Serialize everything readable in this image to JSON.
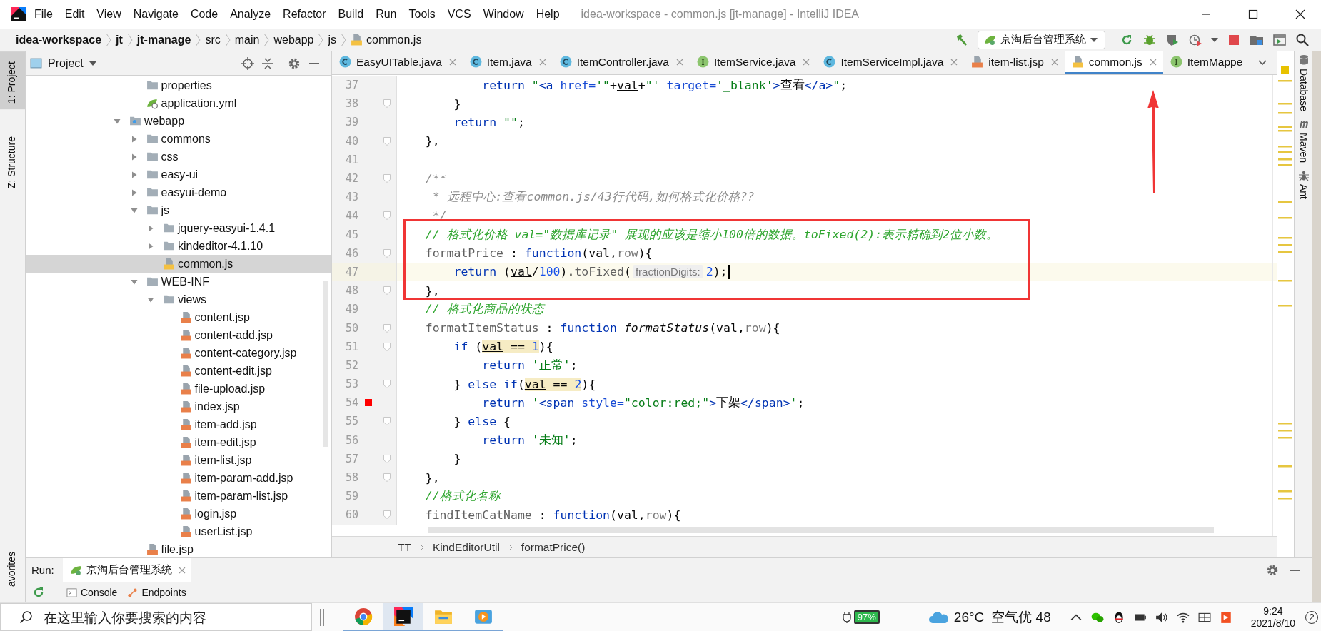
{
  "window": {
    "title": "idea-workspace - common.js [jt-manage] - IntelliJ IDEA"
  },
  "menu": [
    "File",
    "Edit",
    "View",
    "Navigate",
    "Code",
    "Analyze",
    "Refactor",
    "Build",
    "Run",
    "Tools",
    "VCS",
    "Window",
    "Help"
  ],
  "navigation_bar": {
    "crumbs": [
      {
        "label": "idea-workspace",
        "bold": true,
        "kind": "plain"
      },
      {
        "label": "jt",
        "bold": true,
        "kind": "plain"
      },
      {
        "label": "jt-manage",
        "bold": true,
        "kind": "plain"
      },
      {
        "label": "src",
        "bold": false,
        "kind": "plain"
      },
      {
        "label": "main",
        "bold": false,
        "kind": "plain"
      },
      {
        "label": "webapp",
        "bold": false,
        "kind": "plain"
      },
      {
        "label": "js",
        "bold": false,
        "kind": "plain"
      },
      {
        "label": "common.js",
        "bold": false,
        "kind": "js"
      }
    ],
    "run_configuration": "京淘后台管理系统"
  },
  "left_stripe": [
    {
      "label": "1: Project",
      "selected": true
    },
    {
      "label": "Z: Structure",
      "selected": false
    },
    {
      "label": "avorites",
      "selected": false
    }
  ],
  "project_panel": {
    "title": "Project",
    "tree": [
      {
        "children": [
          {
            "label": "properties",
            "kind": "folder",
            "selected": false
          },
          {
            "label": "application.yml",
            "kind": "yml",
            "selected": false
          }
        ]
      },
      {
        "label": "webapp",
        "kind": "web-folder",
        "selected": false,
        "expanded": true,
        "children": [
          {
            "label": "commons",
            "kind": "folder",
            "selected": false,
            "expanded": false
          },
          {
            "label": "css",
            "kind": "folder",
            "selected": false,
            "expanded": false
          },
          {
            "label": "easy-ui",
            "kind": "folder",
            "selected": false,
            "expanded": false
          },
          {
            "label": "easyui-demo",
            "kind": "folder",
            "selected": false,
            "expanded": false
          },
          {
            "label": "js",
            "kind": "folder",
            "selected": false,
            "expanded": true,
            "children": [
              {
                "label": "jquery-easyui-1.4.1",
                "kind": "folder",
                "selected": false,
                "expanded": false
              },
              {
                "label": "kindeditor-4.1.10",
                "kind": "folder",
                "selected": false,
                "expanded": false
              },
              {
                "label": "common.js",
                "kind": "js",
                "selected": true
              }
            ]
          },
          {
            "label": "WEB-INF",
            "kind": "folder",
            "selected": false,
            "expanded": true,
            "children": [
              {
                "label": "views",
                "kind": "folder",
                "selected": false,
                "expanded": true,
                "children": [
                  {
                    "label": "content.jsp",
                    "kind": "jsp",
                    "selected": false
                  },
                  {
                    "label": "content-add.jsp",
                    "kind": "jsp",
                    "selected": false
                  },
                  {
                    "label": "content-category.jsp",
                    "kind": "jsp",
                    "selected": false
                  },
                  {
                    "label": "content-edit.jsp",
                    "kind": "jsp",
                    "selected": false
                  },
                  {
                    "label": "file-upload.jsp",
                    "kind": "jsp",
                    "selected": false
                  },
                  {
                    "label": "index.jsp",
                    "kind": "jsp",
                    "selected": false
                  },
                  {
                    "label": "item-add.jsp",
                    "kind": "jsp",
                    "selected": false
                  },
                  {
                    "label": "item-edit.jsp",
                    "kind": "jsp",
                    "selected": false
                  },
                  {
                    "label": "item-list.jsp",
                    "kind": "jsp",
                    "selected": false
                  },
                  {
                    "label": "item-param-add.jsp",
                    "kind": "jsp",
                    "selected": false
                  },
                  {
                    "label": "item-param-list.jsp",
                    "kind": "jsp",
                    "selected": false
                  },
                  {
                    "label": "login.jsp",
                    "kind": "jsp",
                    "selected": false
                  },
                  {
                    "label": "userList.jsp",
                    "kind": "jsp",
                    "selected": false
                  }
                ]
              }
            ]
          },
          {
            "label": "file.jsp",
            "kind": "jsp",
            "selected": false
          }
        ]
      }
    ]
  },
  "editor_tabs": [
    {
      "label": "EasyUITable.java",
      "kind": "class",
      "selected": false,
      "closable": true
    },
    {
      "label": "Item.java",
      "kind": "class",
      "selected": false,
      "closable": true
    },
    {
      "label": "ItemController.java",
      "kind": "class",
      "selected": false,
      "closable": true
    },
    {
      "label": "ItemService.java",
      "kind": "interface",
      "selected": false,
      "closable": true
    },
    {
      "label": "ItemServiceImpl.java",
      "kind": "class",
      "selected": false,
      "closable": true
    },
    {
      "label": "item-list.jsp",
      "kind": "jsp",
      "selected": false,
      "closable": true
    },
    {
      "label": "common.js",
      "kind": "js",
      "selected": true,
      "closable": true
    },
    {
      "label": "ItemMappe",
      "kind": "interface",
      "selected": false,
      "closable": false
    }
  ],
  "code": {
    "lines": [
      {
        "number": "37",
        "fold": false,
        "breakpoint": false,
        "current": false,
        "tokens": [
          {
            "kind": "keyword",
            "text": "            return"
          },
          {
            "kind": "string",
            "text": " \""
          },
          {
            "kind": "tag",
            "text": "<a"
          },
          {
            "kind": "attr",
            "text": " href="
          },
          {
            "kind": "string",
            "text": "'\""
          },
          {
            "kind": "plain",
            "text": "+"
          },
          {
            "kind": "param",
            "text": "val"
          },
          {
            "kind": "plain",
            "text": "+"
          },
          {
            "kind": "string",
            "text": "\"'"
          },
          {
            "kind": "attr",
            "text": " target="
          },
          {
            "kind": "string",
            "text": "'_blank'"
          },
          {
            "kind": "tag",
            "text": ">"
          },
          {
            "kind": "plain",
            "text": "查看"
          },
          {
            "kind": "tag",
            "text": "</a>"
          },
          {
            "kind": "string",
            "text": "\""
          },
          {
            "kind": "plain",
            "text": ";"
          }
        ]
      },
      {
        "number": "38",
        "fold": true,
        "breakpoint": false,
        "current": false,
        "tokens": [
          {
            "kind": "plain",
            "text": "        }"
          }
        ]
      },
      {
        "number": "39",
        "fold": false,
        "breakpoint": false,
        "current": false,
        "tokens": [
          {
            "kind": "keyword",
            "text": "        return"
          },
          {
            "kind": "string",
            "text": " \"\""
          },
          {
            "kind": "plain",
            "text": ";"
          }
        ]
      },
      {
        "number": "40",
        "fold": true,
        "breakpoint": false,
        "current": false,
        "tokens": [
          {
            "kind": "plain",
            "text": "    },"
          }
        ]
      },
      {
        "number": "41",
        "fold": false,
        "breakpoint": false,
        "current": false
      },
      {
        "number": "42",
        "fold": true,
        "breakpoint": false,
        "current": false,
        "tokens": [
          {
            "kind": "doc",
            "text": "    /**"
          }
        ]
      },
      {
        "number": "43",
        "fold": false,
        "breakpoint": false,
        "current": false,
        "tokens": [
          {
            "kind": "doc",
            "text": "     * 远程中心:查看common.js/43行代码,如何格式化价格??"
          }
        ]
      },
      {
        "number": "44",
        "fold": true,
        "breakpoint": false,
        "current": false,
        "tokens": [
          {
            "kind": "doc",
            "text": "     */"
          }
        ]
      },
      {
        "number": "45",
        "fold": false,
        "breakpoint": false,
        "current": false,
        "tokens": [
          {
            "kind": "comment",
            "text": "    // 格式化价格 val=\"数据库记录\" 展现的应该是缩小100倍的数据。toFixed(2):表示精确到2位小数。"
          }
        ]
      },
      {
        "number": "46",
        "fold": true,
        "breakpoint": false,
        "current": false,
        "tokens": [
          {
            "kind": "property",
            "text": "    formatPrice"
          },
          {
            "kind": "plain",
            "text": " : "
          },
          {
            "kind": "keyword",
            "text": "function"
          },
          {
            "kind": "plain",
            "text": "("
          },
          {
            "kind": "param",
            "text": "val"
          },
          {
            "kind": "plain",
            "text": ","
          },
          {
            "kind": "unused-param",
            "text": "row"
          },
          {
            "kind": "plain",
            "text": "){"
          }
        ]
      },
      {
        "number": "47",
        "fold": false,
        "breakpoint": false,
        "current": true,
        "tokens": [
          {
            "kind": "keyword",
            "text": "        return"
          },
          {
            "kind": "plain",
            "text": " ("
          },
          {
            "kind": "param",
            "text": "val"
          },
          {
            "kind": "plain",
            "text": "/"
          },
          {
            "kind": "number",
            "text": "100"
          },
          {
            "kind": "plain",
            "text": ")."
          },
          {
            "kind": "method",
            "text": "toFixed"
          },
          {
            "kind": "plain",
            "text": "("
          },
          {
            "kind": "hint",
            "text": "fractionDigits:"
          },
          {
            "kind": "number",
            "text": "2"
          },
          {
            "kind": "plain",
            "text": ");"
          }
        ]
      },
      {
        "number": "48",
        "fold": true,
        "breakpoint": false,
        "current": false,
        "tokens": [
          {
            "kind": "plain",
            "text": "    },"
          }
        ]
      },
      {
        "number": "49",
        "fold": false,
        "breakpoint": false,
        "current": false,
        "tokens": [
          {
            "kind": "comment",
            "text": "    // 格式化商品的状态"
          }
        ]
      },
      {
        "number": "50",
        "fold": true,
        "breakpoint": false,
        "current": false,
        "tokens": [
          {
            "kind": "property",
            "text": "    formatItemStatus"
          },
          {
            "kind": "plain",
            "text": " : "
          },
          {
            "kind": "keyword",
            "text": "function"
          },
          {
            "kind": "function-name",
            "text": " formatStatus"
          },
          {
            "kind": "plain",
            "text": "("
          },
          {
            "kind": "param",
            "text": "val"
          },
          {
            "kind": "plain",
            "text": ","
          },
          {
            "kind": "unused-param",
            "text": "row"
          },
          {
            "kind": "plain",
            "text": "){"
          }
        ]
      },
      {
        "number": "51",
        "fold": true,
        "breakpoint": false,
        "current": false,
        "tokens": [
          {
            "kind": "keyword",
            "text": "        if"
          },
          {
            "kind": "plain",
            "text": " ("
          },
          {
            "kind": "param-hl",
            "text": "val"
          },
          {
            "kind": "plain-hl",
            "text": " == "
          },
          {
            "kind": "number-hl",
            "text": "1"
          },
          {
            "kind": "plain",
            "text": "){"
          }
        ]
      },
      {
        "number": "52",
        "fold": false,
        "breakpoint": false,
        "current": false,
        "tokens": [
          {
            "kind": "keyword",
            "text": "            return"
          },
          {
            "kind": "string",
            "text": " '正常'"
          },
          {
            "kind": "plain",
            "text": ";"
          }
        ]
      },
      {
        "number": "53",
        "fold": true,
        "breakpoint": false,
        "current": false,
        "tokens": [
          {
            "kind": "plain",
            "text": "        } "
          },
          {
            "kind": "keyword",
            "text": "else if"
          },
          {
            "kind": "plain",
            "text": "("
          },
          {
            "kind": "param-hl",
            "text": "val"
          },
          {
            "kind": "plain-hl",
            "text": " == "
          },
          {
            "kind": "number-hl",
            "text": "2"
          },
          {
            "kind": "plain",
            "text": "){"
          }
        ]
      },
      {
        "number": "54",
        "fold": false,
        "breakpoint": true,
        "current": false,
        "tokens": [
          {
            "kind": "keyword",
            "text": "            return"
          },
          {
            "kind": "string",
            "text": " '"
          },
          {
            "kind": "tag",
            "text": "<span"
          },
          {
            "kind": "attr",
            "text": " style="
          },
          {
            "kind": "string",
            "text": "\"color:red;\""
          },
          {
            "kind": "tag",
            "text": ">"
          },
          {
            "kind": "plain",
            "text": "下架"
          },
          {
            "kind": "tag",
            "text": "</span>"
          },
          {
            "kind": "string",
            "text": "'"
          },
          {
            "kind": "plain",
            "text": ";"
          }
        ]
      },
      {
        "number": "55",
        "fold": true,
        "breakpoint": false,
        "current": false,
        "tokens": [
          {
            "kind": "plain",
            "text": "        } "
          },
          {
            "kind": "keyword",
            "text": "else"
          },
          {
            "kind": "plain",
            "text": " {"
          }
        ]
      },
      {
        "number": "56",
        "fold": false,
        "breakpoint": false,
        "current": false,
        "tokens": [
          {
            "kind": "keyword",
            "text": "            return"
          },
          {
            "kind": "string",
            "text": " '未知'"
          },
          {
            "kind": "plain",
            "text": ";"
          }
        ]
      },
      {
        "number": "57",
        "fold": true,
        "breakpoint": false,
        "current": false,
        "tokens": [
          {
            "kind": "plain",
            "text": "        }"
          }
        ]
      },
      {
        "number": "58",
        "fold": true,
        "breakpoint": false,
        "current": false,
        "tokens": [
          {
            "kind": "plain",
            "text": "    },"
          }
        ]
      },
      {
        "number": "59",
        "fold": false,
        "breakpoint": false,
        "current": false,
        "tokens": [
          {
            "kind": "comment",
            "text": "    //格式化名称"
          }
        ]
      },
      {
        "number": "60",
        "fold": true,
        "breakpoint": false,
        "current": false,
        "tokens": [
          {
            "kind": "property",
            "text": "    findItemCatName"
          },
          {
            "kind": "plain",
            "text": " : "
          },
          {
            "kind": "keyword",
            "text": "function"
          },
          {
            "kind": "plain",
            "text": "("
          },
          {
            "kind": "param",
            "text": "val"
          },
          {
            "kind": "plain",
            "text": ","
          },
          {
            "kind": "unused-param",
            "text": "row"
          },
          {
            "kind": "plain",
            "text": "){"
          }
        ]
      }
    ]
  },
  "breadcrumbs": [
    "TT",
    "KindEditorUtil",
    "formatPrice()"
  ],
  "annotations": {
    "frame": true,
    "arrow": true
  },
  "right_stripe": [
    {
      "label": "Database",
      "kind": "database"
    },
    {
      "label": "Maven",
      "kind": "maven"
    },
    {
      "label": "Ant",
      "kind": "ant"
    }
  ],
  "run_panel": {
    "label": "Run:",
    "tab": "京淘后台管理系统",
    "console_tabs": [
      {
        "label": "Console",
        "kind": "console"
      },
      {
        "label": "Endpoints",
        "kind": "endpoints"
      }
    ]
  },
  "taskbar": {
    "search": {
      "placeholder": "在这里输入你要搜索的内容"
    },
    "apps": [
      {
        "kind": "browser",
        "active": false
      },
      {
        "kind": "ide",
        "active": true
      },
      {
        "kind": "files",
        "active": false
      },
      {
        "kind": "player",
        "active": false
      }
    ],
    "battery": "97%",
    "weather": {
      "temperature": "26°C",
      "air": "空气优 48"
    },
    "time": "9:24",
    "date": "2021/8/10",
    "notifications": "2"
  }
}
